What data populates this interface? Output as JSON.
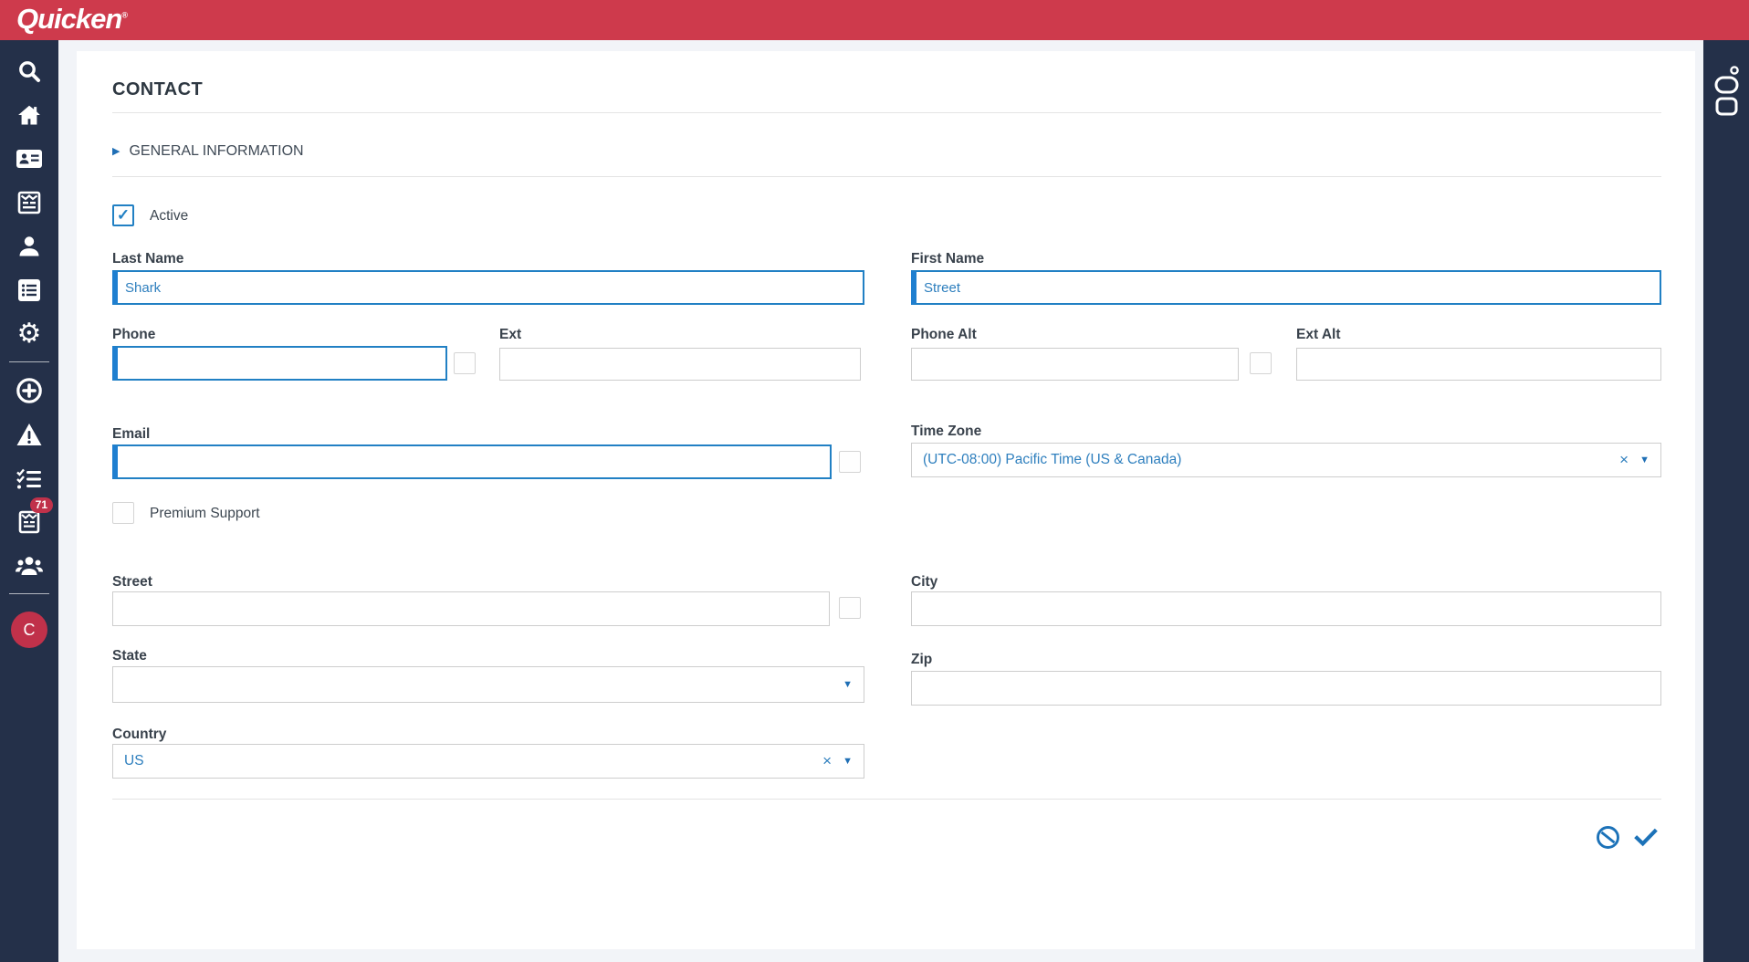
{
  "header": {
    "logo": "Quicken",
    "registered": "®",
    "brand_color": "#ce3a4c"
  },
  "sidebar": {
    "background": "#243049",
    "items": [
      {
        "icon": "search"
      },
      {
        "icon": "home"
      },
      {
        "icon": "address-card"
      },
      {
        "icon": "order-form"
      },
      {
        "icon": "user"
      },
      {
        "icon": "list"
      },
      {
        "icon": "settings"
      },
      {
        "icon": "add-circle"
      },
      {
        "icon": "alerts"
      },
      {
        "icon": "tasks"
      },
      {
        "icon": "forms"
      },
      {
        "icon": "teams"
      }
    ],
    "badge_count": "71",
    "avatar_initial": "C"
  },
  "form": {
    "title": "CONTACT",
    "section": "GENERAL INFORMATION",
    "active": {
      "label": "Active",
      "checked": true
    },
    "fields": {
      "last_name": {
        "label": "Last Name",
        "value": "Shark"
      },
      "first_name": {
        "label": "First Name",
        "value": "Street"
      },
      "phone": {
        "label": "Phone",
        "value": ""
      },
      "ext": {
        "label": "Ext",
        "value": ""
      },
      "phone_alt": {
        "label": "Phone Alt",
        "value": ""
      },
      "ext_alt": {
        "label": "Ext Alt",
        "value": ""
      },
      "email": {
        "label": "Email",
        "value": ""
      },
      "time_zone": {
        "label": "Time Zone",
        "value": "(UTC-08:00) Pacific Time (US & Canada)"
      },
      "premium_support": {
        "label": "Premium Support",
        "checked": false
      },
      "street": {
        "label": "Street",
        "value": ""
      },
      "city": {
        "label": "City",
        "value": ""
      },
      "state": {
        "label": "State",
        "value": ""
      },
      "zip": {
        "label": "Zip",
        "value": ""
      },
      "country": {
        "label": "Country",
        "value": "US"
      }
    }
  },
  "icons": {
    "collapse_arrow": "▶",
    "dropdown_arrow": "▼",
    "clear": "×"
  },
  "colors": {
    "accent_blue": "#2180c4",
    "link_blue": "#2e7fbe",
    "navy": "#243049",
    "brand_red": "#ce3a4c",
    "badge_red": "#c0314a"
  }
}
